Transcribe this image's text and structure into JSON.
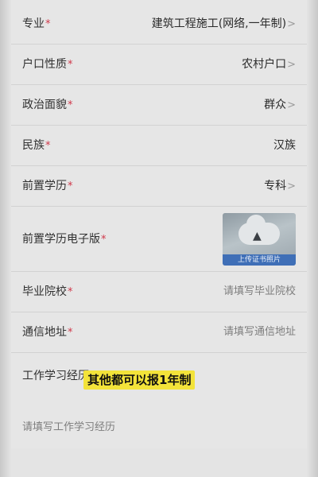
{
  "required_mark": "*",
  "chevron": ">",
  "fields": [
    {
      "label": "专业",
      "value": "建筑工程施工(网络,一年制)",
      "chevron": true,
      "placeholder": false
    },
    {
      "label": "户口性质",
      "value": "农村户口",
      "chevron": true,
      "placeholder": false
    },
    {
      "label": "政治面貌",
      "value": "群众",
      "chevron": true,
      "placeholder": false
    },
    {
      "label": "民族",
      "value": "汉族",
      "chevron": false,
      "placeholder": false
    },
    {
      "label": "前置学历",
      "value": "专科",
      "chevron": true,
      "placeholder": false
    }
  ],
  "photo_field": {
    "label": "前置学历电子版",
    "upload_label": "上传证书照片"
  },
  "school_field": {
    "label": "毕业院校",
    "placeholder": "请填写毕业院校"
  },
  "address_field": {
    "label": "通信地址",
    "placeholder": "请填写通信地址"
  },
  "experience_field": {
    "label": "工作学习经历",
    "placeholder": "请填写工作学习经历"
  },
  "caption": "其他都可以报1年制",
  "colors": {
    "required": "#d0384a",
    "caption_bg": "#f3e33a",
    "upload_bar": "#3f6fb7"
  }
}
